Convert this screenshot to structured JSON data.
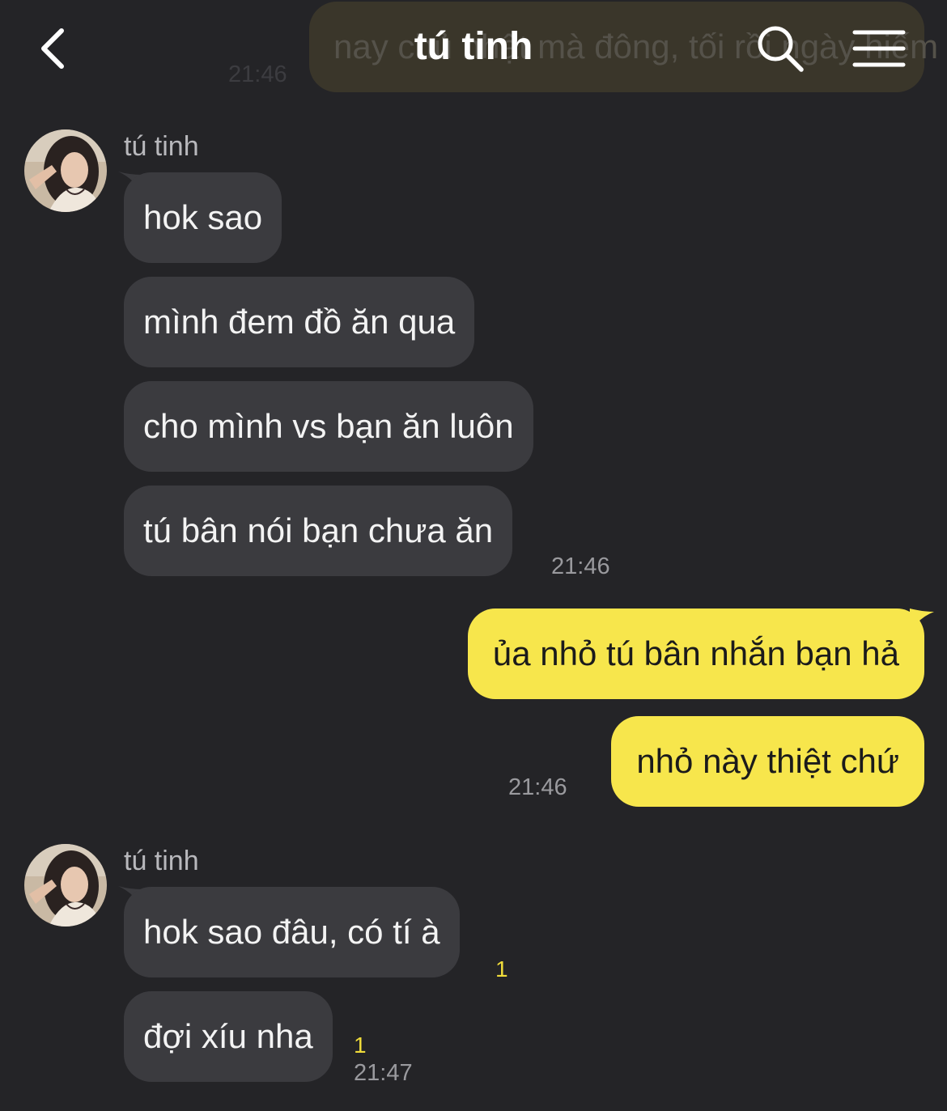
{
  "header": {
    "title": "tú tinh",
    "back_icon": "chevron-left-icon",
    "search_icon": "search-icon",
    "menu_icon": "menu-icon"
  },
  "ghost": {
    "text": "nay chủ nhật mà đông, tối rồi ngày hiếm",
    "time": "21:46"
  },
  "groups": [
    {
      "sender": "tú tinh",
      "messages": [
        "hok sao",
        "mình đem đồ ăn qua",
        "cho mình vs bạn ăn luôn",
        "tú bân nói bạn chưa ăn"
      ],
      "time": "21:46"
    },
    {
      "outgoing": true,
      "messages": [
        "ủa nhỏ tú bân nhắn bạn hả",
        "nhỏ này thiệt chứ"
      ],
      "time": "21:46"
    },
    {
      "sender": "tú tinh",
      "messages": [
        "hok sao đâu, có tí à",
        "đợi xíu nha"
      ],
      "unread": [
        "1",
        "1"
      ],
      "time": "21:47"
    }
  ],
  "colors": {
    "background": "#242427",
    "incoming_bubble": "#3b3b3f",
    "outgoing_bubble": "#f7e64c",
    "unread": "#f0dc3a"
  }
}
